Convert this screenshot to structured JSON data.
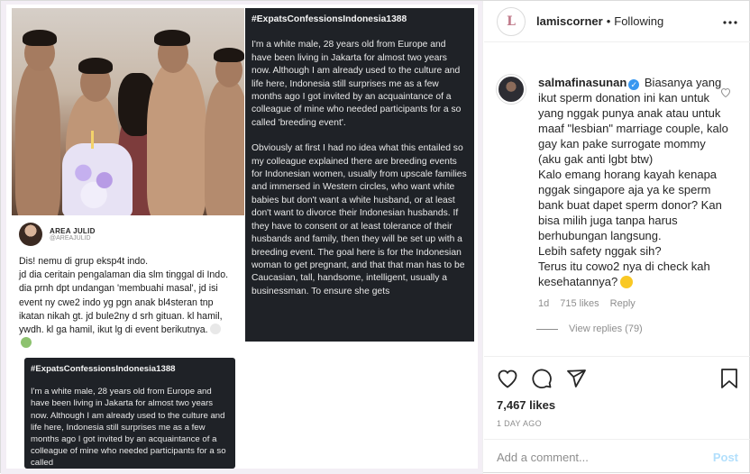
{
  "post": {
    "author": "lamiscorner",
    "separator": "•",
    "follow_status": "Following",
    "avatar_letter": "L",
    "likes": "7,467 likes",
    "date": "1 DAY AGO"
  },
  "comment": {
    "username": "salmafinasunan",
    "text": "Biasanya yang ikut sperm donation ini kan untuk yang nggak punya anak atau untuk maaf \"lesbian\" marriage couple, kalo gay kan pake surrogate mommy (aku gak anti lgbt btw)\nKalo emang horang kayah kenapa nggak singapore aja ya ke sperm bank buat dapet sperm donor? Kan bisa milih juga tanpa harus berhubungan langsung.\nLebih safety nggak sih?\nTerus itu cowo2 nya di check kah kesehatannya?",
    "age": "1d",
    "likes": "715 likes",
    "reply_label": "Reply",
    "view_replies": "View replies (79)"
  },
  "comment_box": {
    "placeholder": "Add a comment...",
    "post_label": "Post"
  },
  "image": {
    "tweet": {
      "name": "AREA JULID",
      "handle": "@AREAJULID",
      "text": "Dis! nemu di grup eksp4t indo.\njd dia ceritain pengalaman dia slm tinggal di Indo. dia prnh dpt undangan 'membuahi masal', jd isi event ny cwe2 indo yg pgn anak bl4steran tnp ikatan nikah gt. jd bule2ny d srh gituan. kl hamil, ywdh. kl ga hamil, ikut lg di event berikutnya."
    },
    "confession_big": {
      "hashtag": "#ExpatsConfessionsIndonesia1388",
      "para1": "I'm a white male, 28 years old from Europe and have been living in Jakarta for almost two years now. Although I am already used to the culture and life here, Indonesia still surprises me as a few months ago I got invited by an acquaintance of a colleague of mine who needed participants for a so called 'breeding event'.",
      "para2": "Obviously at first I had no idea what this entailed so my colleague explained there are breeding events for Indonesian women, usually from upscale families and immersed in Western circles, who want white babies but don't want a white husband, or at least don't want to divorce their Indonesian husbands. If they have to consent or at least tolerance of their husbands and family, then they will be set up with a breeding event. The goal here is for the Indonesian woman to get pregnant, and that that man has to be Caucasian, tall, handsome, intelligent, usually a businessman. To ensure she gets"
    },
    "confession_small": {
      "hashtag": "#ExpatsConfessionsIndonesia1388",
      "para1": "I'm a white male, 28 years old from Europe and have been living in Jakarta for almost two years now. Although I am already used to the culture and life here, Indonesia still surprises me as a few months ago I got invited by an acquaintance of a colleague of mine who needed participants for a so called"
    }
  },
  "colors": {
    "dark_card": "#1f2227",
    "verified": "#3897f0",
    "post_button": "#b2dffc"
  },
  "icons": [
    "more-horizontal-icon",
    "heart-icon",
    "comment-icon",
    "share-icon",
    "bookmark-icon",
    "verified-icon"
  ]
}
